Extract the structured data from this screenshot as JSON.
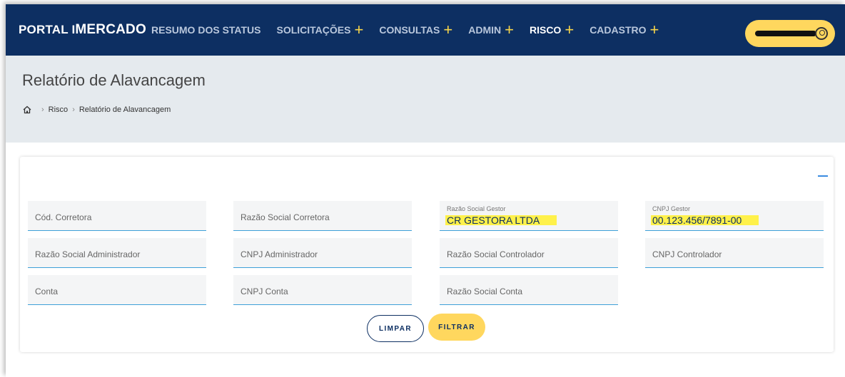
{
  "navbar": {
    "brand_part1": "Portal i",
    "brand_part2": "Mercado",
    "items": [
      {
        "label": "RESUMO DOS STATUS",
        "has_plus": false
      },
      {
        "label": "SOLICITAÇÕES",
        "has_plus": true
      },
      {
        "label": "CONSULTAS",
        "has_plus": true
      },
      {
        "label": "ADMIN",
        "has_plus": true
      },
      {
        "label": "RISCO",
        "has_plus": true,
        "active": true
      },
      {
        "label": "CADASTRO",
        "has_plus": true
      }
    ],
    "plus_symbol": "+",
    "accent_color": "#ffd75e",
    "bg_color": "#0d2f62"
  },
  "header": {
    "title": "Relatório de Alavancagem",
    "breadcrumb": [
      "Risco",
      "Relatório de Alavancagem"
    ],
    "separator": "›"
  },
  "filters": {
    "cod_corretora": {
      "placeholder": "Cód. Corretora"
    },
    "razao_social_corretora": {
      "placeholder": "Razão Social Corretora"
    },
    "razao_social_gestor": {
      "label": "Razão Social Gestor",
      "value": "CR GESTORA LTDA"
    },
    "cnpj_gestor": {
      "label": "CNPJ Gestor",
      "value": "00.123.456/7891-00"
    },
    "razao_social_administrador": {
      "placeholder": "Razão Social Administrador"
    },
    "cnpj_administrador": {
      "placeholder": "CNPJ Administrador"
    },
    "razao_social_controlador": {
      "placeholder": "Razão Social Controlador"
    },
    "cnpj_controlador": {
      "placeholder": "CNPJ Controlador"
    },
    "conta": {
      "placeholder": "Conta"
    },
    "cnpj_conta": {
      "placeholder": "CNPJ Conta"
    },
    "razao_social_conta": {
      "placeholder": "Razão Social Conta"
    }
  },
  "actions": {
    "clear_label": "LIMPAR",
    "filter_label": "FILTRAR"
  }
}
